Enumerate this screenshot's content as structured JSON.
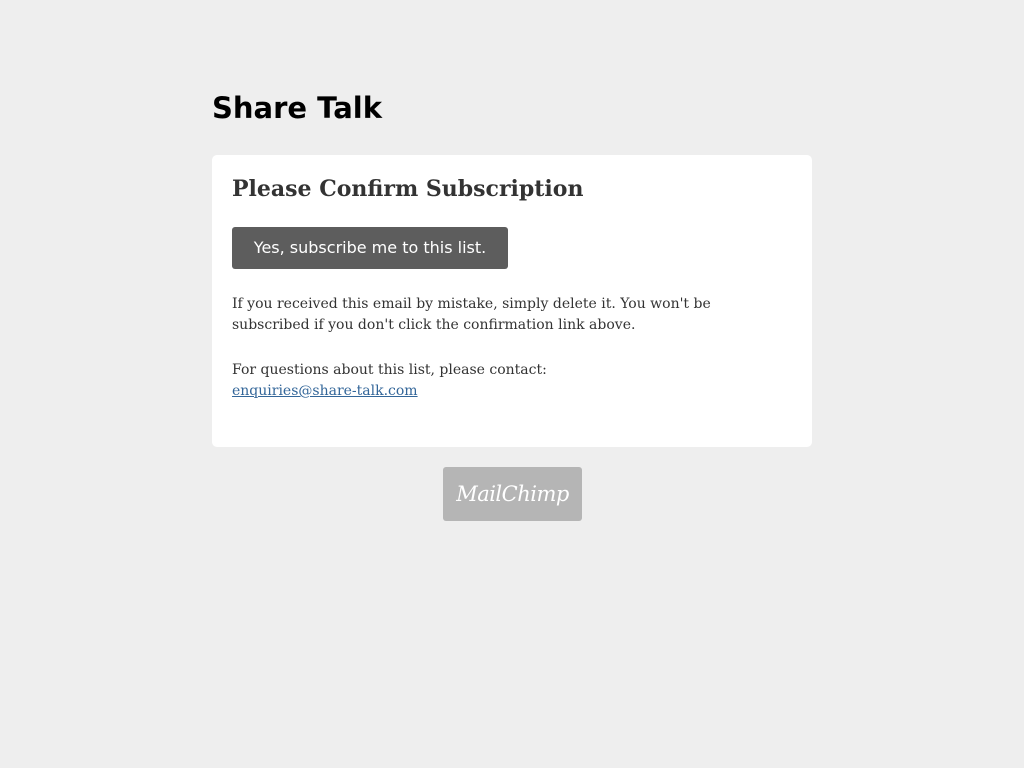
{
  "site": {
    "title": "Share Talk"
  },
  "card": {
    "heading": "Please Confirm Subscription",
    "confirm_button_label": "Yes, subscribe me to this list.",
    "notice_text": "If you received this email by mistake, simply delete it. You won't be subscribed if you don't click the confirmation link above.",
    "contact_prompt": "For questions about this list, please contact:",
    "contact_email": "enquiries@share-talk.com"
  },
  "footer": {
    "badge_label": "MailChimp"
  },
  "colors": {
    "background": "#eeeeee",
    "card": "#ffffff",
    "button": "#5d5d5d",
    "link": "#336699",
    "badge": "#b5b5b5"
  }
}
